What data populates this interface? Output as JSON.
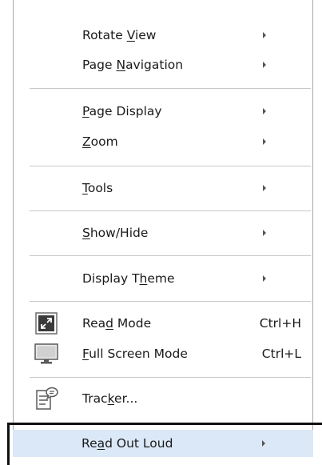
{
  "menu": {
    "items": [
      {
        "label_pre": "Rotate ",
        "label_key": "V",
        "label_post": "iew"
      },
      {
        "label_pre": "Page ",
        "label_key": "N",
        "label_post": "avigation"
      },
      {
        "label_pre": "",
        "label_key": "P",
        "label_post": "age Display"
      },
      {
        "label_pre": "",
        "label_key": "Z",
        "label_post": "oom"
      },
      {
        "label_pre": "",
        "label_key": "T",
        "label_post": "ools"
      },
      {
        "label_pre": "",
        "label_key": "S",
        "label_post": "how/Hide"
      },
      {
        "label_pre": "Display T",
        "label_key": "h",
        "label_post": "eme"
      },
      {
        "label_pre": "Rea",
        "label_key": "d",
        "label_post": " Mode",
        "shortcut": "Ctrl+H",
        "icon": "read-mode-icon"
      },
      {
        "label_pre": "",
        "label_key": "F",
        "label_post": "ull Screen Mode",
        "shortcut": "Ctrl+L",
        "icon": "full-screen-icon"
      },
      {
        "label_pre": "Trac",
        "label_key": "k",
        "label_post": "er...",
        "icon": "tracker-icon"
      },
      {
        "label_pre": "Re",
        "label_key": "a",
        "label_post": "d Out Loud"
      }
    ]
  },
  "colors": {
    "highlight": "#dbe8f7",
    "separator": "#c8c8c8",
    "border": "#a9a9a9",
    "selection_outline": "#111111"
  }
}
